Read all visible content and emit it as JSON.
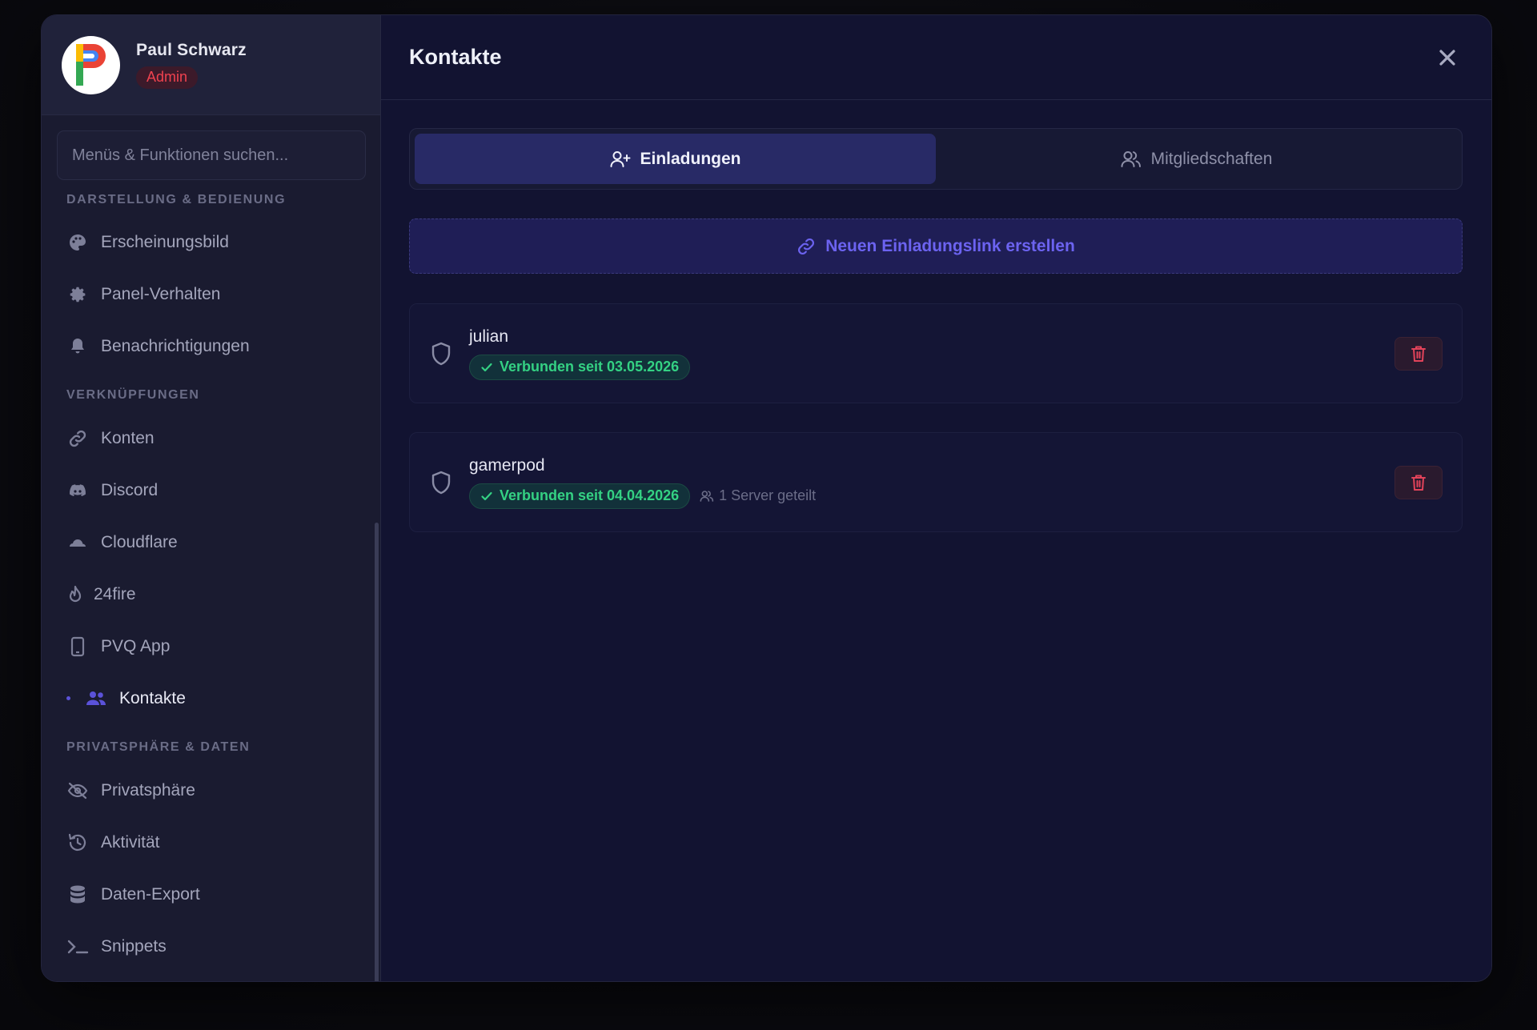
{
  "profile": {
    "name": "Paul Schwarz",
    "role": "Admin"
  },
  "sidebar": {
    "search_placeholder": "Menüs & Funktionen suchen...",
    "sections": [
      {
        "title": "Darstellung & Bedienung",
        "items": [
          {
            "label": "Erscheinungsbild",
            "icon": "palette-icon"
          },
          {
            "label": "Panel-Verhalten",
            "icon": "gear-icon"
          },
          {
            "label": "Benachrichtigungen",
            "icon": "bell-icon"
          }
        ]
      },
      {
        "title": "Verknüpfungen",
        "items": [
          {
            "label": "Konten",
            "icon": "link-icon"
          },
          {
            "label": "Discord",
            "icon": "discord-icon"
          },
          {
            "label": "Cloudflare",
            "icon": "cloud-icon"
          },
          {
            "label": "24fire",
            "icon": "flame-icon"
          },
          {
            "label": "PVQ App",
            "icon": "phone-icon"
          },
          {
            "label": "Kontakte",
            "icon": "users-icon",
            "active": true
          }
        ]
      },
      {
        "title": "Privatsphäre & Daten",
        "items": [
          {
            "label": "Privatsphäre",
            "icon": "eye-off-icon"
          },
          {
            "label": "Aktivität",
            "icon": "history-icon"
          },
          {
            "label": "Daten-Export",
            "icon": "database-icon"
          },
          {
            "label": "Snippets",
            "icon": "terminal-icon"
          }
        ]
      }
    ]
  },
  "main": {
    "title": "Kontakte",
    "tabs": [
      {
        "label": "Einladungen",
        "active": true,
        "icon": "user-plus-icon"
      },
      {
        "label": "Mitgliedschaften",
        "active": false,
        "icon": "users-icon"
      }
    ],
    "create_link_label": "Neuen Einladungslink erstellen",
    "contacts": [
      {
        "name": "julian",
        "status": "Verbunden seit 03.05.2026",
        "extra": ""
      },
      {
        "name": "gamerpod",
        "status": "Verbunden seit 04.04.2026",
        "extra": "1 Server geteilt"
      }
    ]
  },
  "colors": {
    "accent": "#6c63f0",
    "success": "#34d183",
    "danger": "#f0424f",
    "background": "#121331"
  }
}
